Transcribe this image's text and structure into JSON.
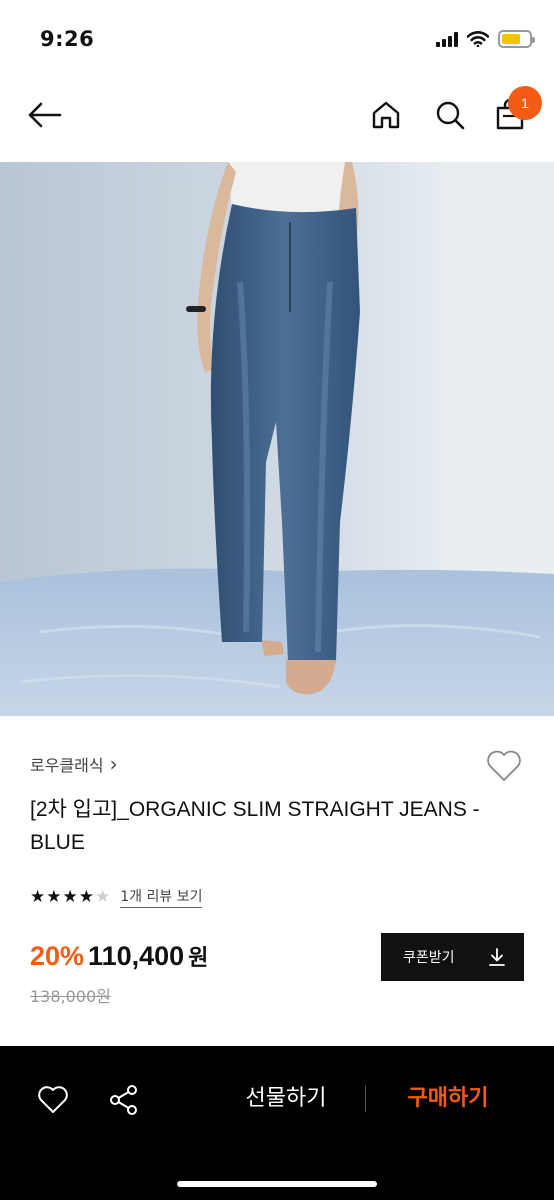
{
  "status": {
    "time": "9:26",
    "battery_level": 0.7,
    "battery_color": "#f5c400"
  },
  "nav": {
    "back_icon": "arrow-left-icon",
    "home_icon": "home-icon",
    "search_icon": "search-icon",
    "bag_icon": "shopping-bag-icon",
    "cart_count": "1",
    "badge_color": "#f45b14"
  },
  "product": {
    "image_icon": "product-photo",
    "brand": "로우클래식",
    "brand_chevron": "›",
    "title": "[2차 입고]_ORGANIC SLIM STRAIGHT JEANS - BLUE",
    "rating": 4,
    "rating_max": 5,
    "review_link": "1개 리뷰 보기",
    "discount": "20%",
    "price": "110,400",
    "price_unit": "원",
    "original_price": "138,000원",
    "coupon_label": "쿠폰받기",
    "accent_color": "#f45b14"
  },
  "bottom_bar": {
    "wishlist_icon": "heart-icon",
    "share_icon": "share-icon",
    "gift_label": "선물하기",
    "buy_label": "구매하기"
  }
}
